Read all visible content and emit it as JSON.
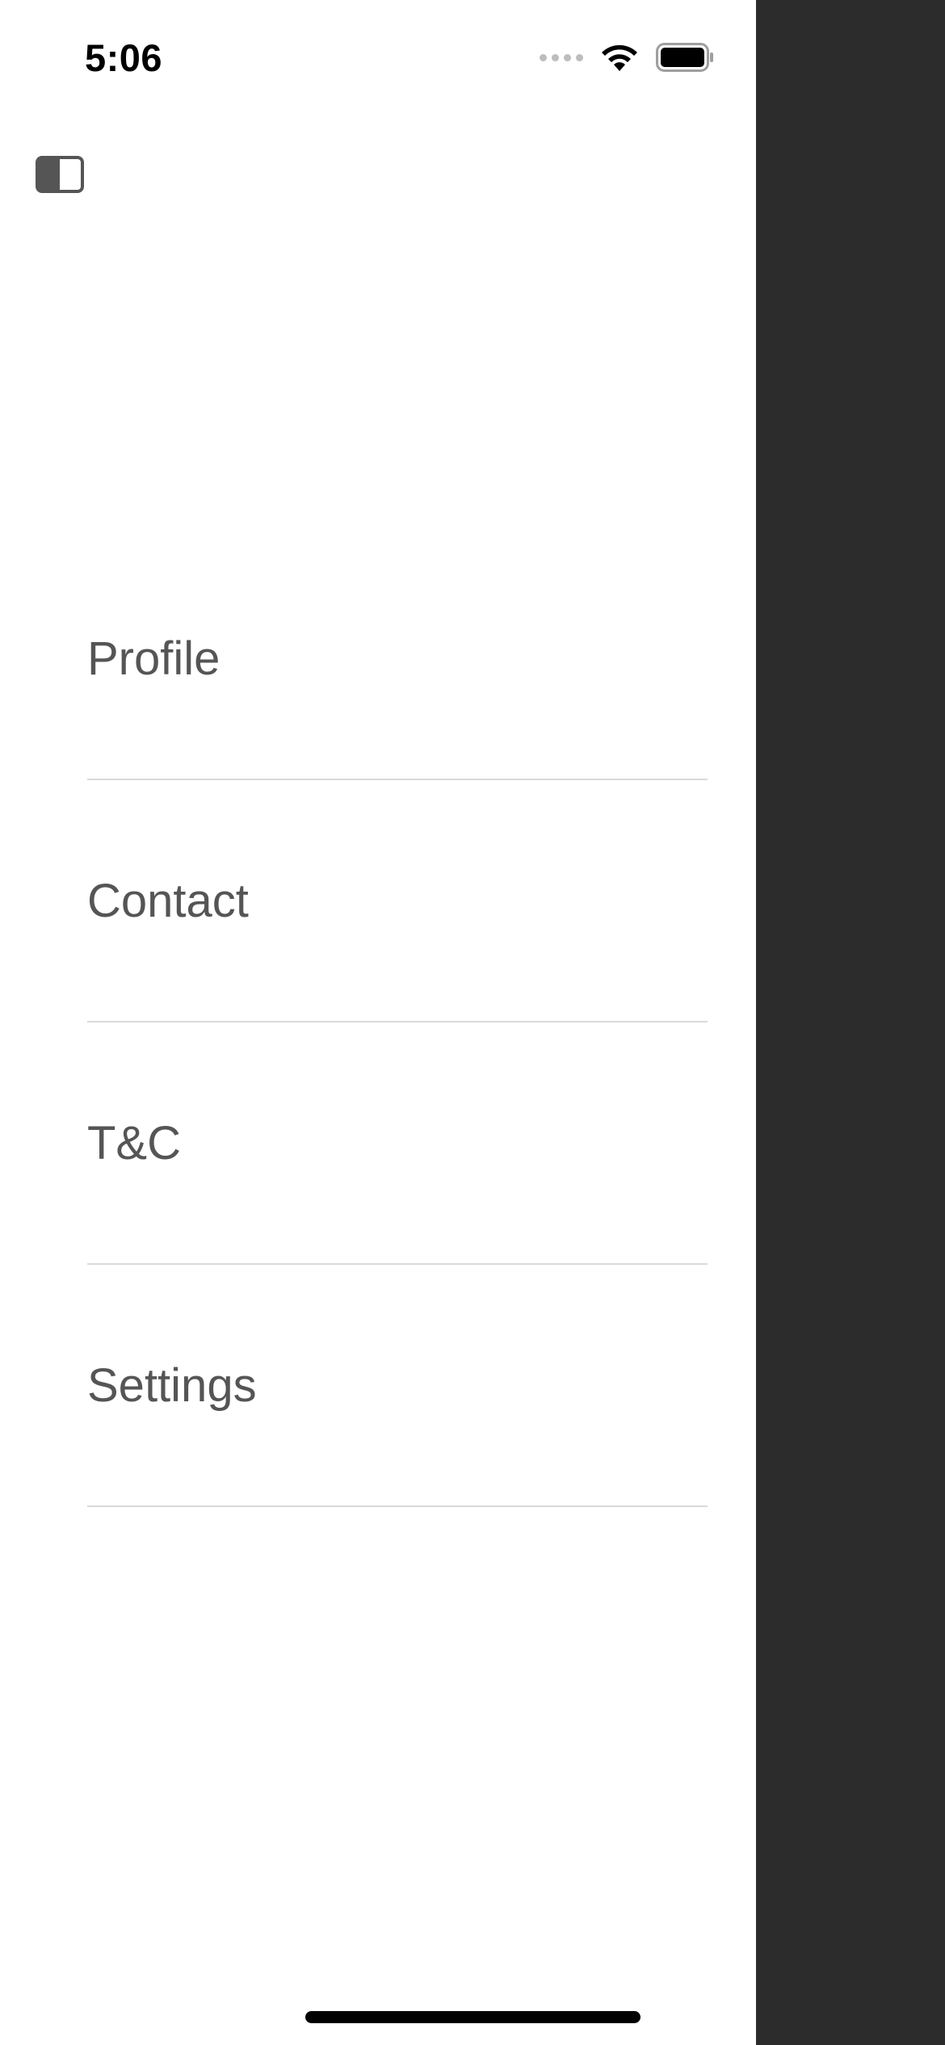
{
  "status_bar": {
    "time": "5:06"
  },
  "toolbar": {
    "sidebar_toggle_icon": "sidebar-left-icon"
  },
  "menu": {
    "items": [
      {
        "label": "Profile"
      },
      {
        "label": "Contact"
      },
      {
        "label": "T&C"
      },
      {
        "label": "Settings"
      }
    ]
  },
  "colors": {
    "drawer_background": "#ffffff",
    "overlay": "#2c2c2c",
    "menu_text": "#555555",
    "divider": "#d9d9d9"
  }
}
